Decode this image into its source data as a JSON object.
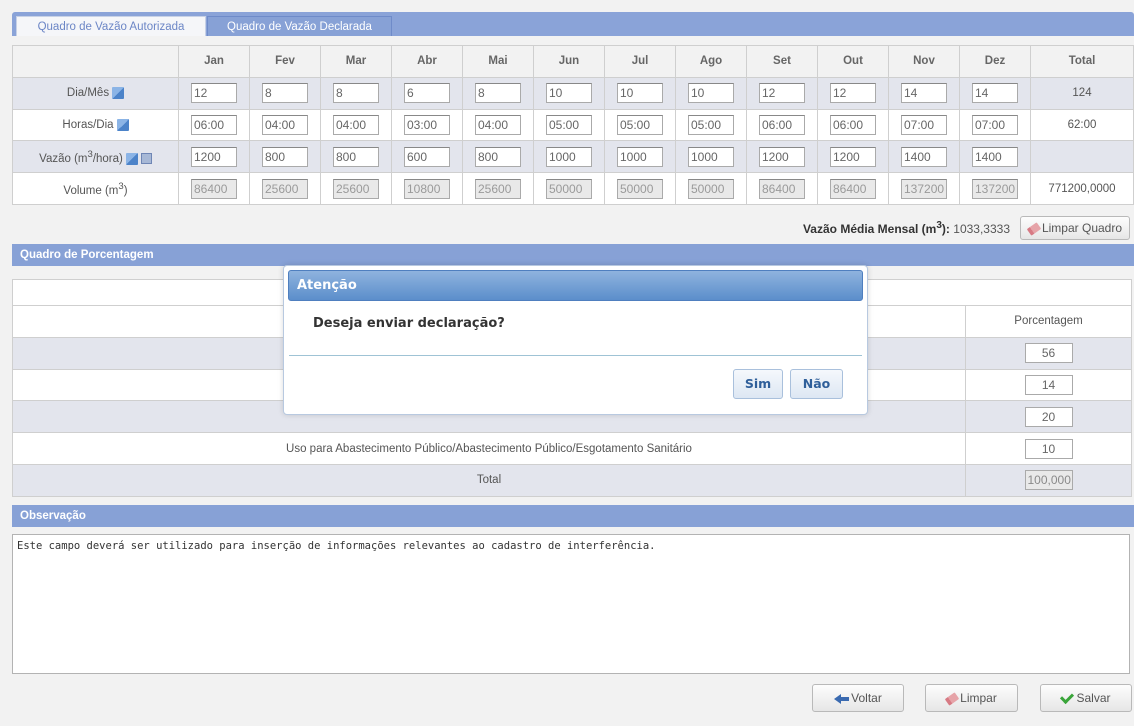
{
  "tabs": {
    "autorizada": "Quadro de Vazão Autorizada",
    "declarada": "Quadro de Vazão Declarada"
  },
  "vazao_table": {
    "months": [
      "Jan",
      "Fev",
      "Mar",
      "Abr",
      "Mai",
      "Jun",
      "Jul",
      "Ago",
      "Set",
      "Out",
      "Nov",
      "Dez"
    ],
    "total_header": "Total",
    "rows": {
      "dia_mes": {
        "label": "Dia/Mês",
        "values": [
          "12",
          "8",
          "8",
          "6",
          "8",
          "10",
          "10",
          "10",
          "12",
          "12",
          "14",
          "14"
        ],
        "total": "124"
      },
      "horas_dia": {
        "label": "Horas/Dia",
        "values": [
          "06:00",
          "04:00",
          "04:00",
          "03:00",
          "04:00",
          "05:00",
          "05:00",
          "05:00",
          "06:00",
          "06:00",
          "07:00",
          "07:00"
        ],
        "total": "62:00"
      },
      "vazao": {
        "label": "Vazão (m",
        "sup": "3",
        "label_end": "/hora)",
        "values": [
          "1200",
          "800",
          "800",
          "600",
          "800",
          "1000",
          "1000",
          "1000",
          "1200",
          "1200",
          "1400",
          "1400"
        ],
        "total": ""
      },
      "volume": {
        "label": "Volume (m",
        "sup": "3",
        "label_end": ")",
        "values": [
          "86400",
          "25600",
          "25600",
          "10800",
          "25600",
          "50000",
          "50000",
          "50000",
          "86400",
          "86400",
          "137200",
          "137200"
        ],
        "total": "771200,0000"
      }
    }
  },
  "media": {
    "label": "Vazão Média Mensal (m",
    "sup": "3",
    "label_end": "):",
    "value": "1033,3333"
  },
  "buttons": {
    "limpar_quadro": "Limpar Quadro",
    "voltar": "Voltar",
    "limpar": "Limpar",
    "salvar": "Salvar"
  },
  "porcentagem": {
    "title": "Quadro de Porcentagem",
    "header": "Porcentagem",
    "rows": [
      {
        "label": "",
        "value": "56"
      },
      {
        "label": "",
        "value": "14"
      },
      {
        "label": "",
        "value": "20"
      },
      {
        "label": "Uso para Abastecimento Público/Abastecimento Público/Esgotamento Sanitário",
        "value": "10"
      }
    ],
    "total_label": "Total",
    "total_value": "100,000"
  },
  "observacao": {
    "title": "Observação",
    "text": "Este campo deverá ser utilizado para inserção de informações relevantes ao cadastro de interferência."
  },
  "dialog": {
    "title": "Atenção",
    "message": "Deseja enviar declaração?",
    "yes": "Sim",
    "no": "Não"
  }
}
